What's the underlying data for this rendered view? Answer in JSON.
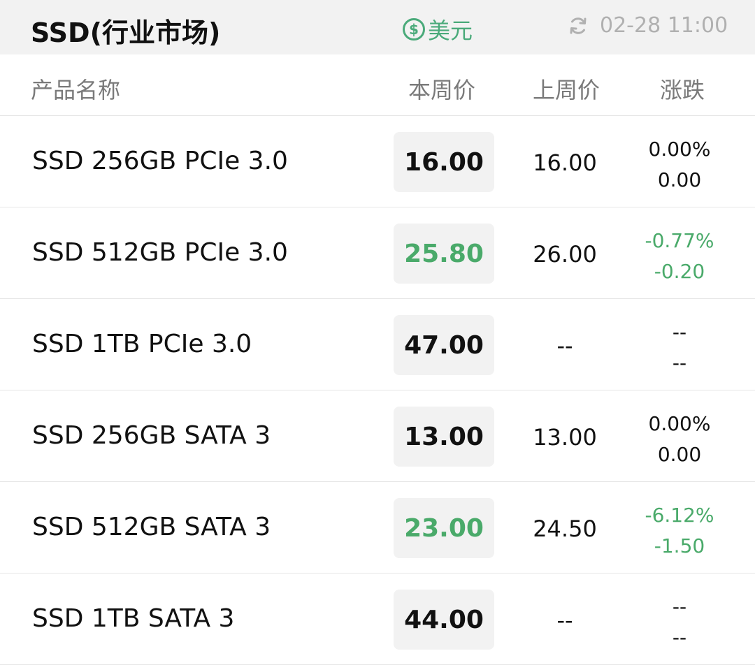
{
  "topbar": {
    "title": "SSD(行业市场)",
    "currency_symbol": "$",
    "currency_label": "美元",
    "updated_time": "02-28 11:00"
  },
  "table": {
    "headers": {
      "name": "产品名称",
      "this_week": "本周价",
      "last_week": "上周价",
      "change": "涨跌"
    },
    "rows": [
      {
        "name": "SSD 256GB PCIe 3.0",
        "this_week": "16.00",
        "last_week": "16.00",
        "change_pct": "0.00%",
        "change_abs": "0.00",
        "trend": "flat"
      },
      {
        "name": "SSD 512GB PCIe 3.0",
        "this_week": "25.80",
        "last_week": "26.00",
        "change_pct": "-0.77%",
        "change_abs": "-0.20",
        "trend": "down"
      },
      {
        "name": "SSD 1TB PCIe 3.0",
        "this_week": "47.00",
        "last_week": "--",
        "change_pct": "--",
        "change_abs": "--",
        "trend": "flat"
      },
      {
        "name": "SSD 256GB SATA 3",
        "this_week": "13.00",
        "last_week": "13.00",
        "change_pct": "0.00%",
        "change_abs": "0.00",
        "trend": "flat"
      },
      {
        "name": "SSD 512GB SATA 3",
        "this_week": "23.00",
        "last_week": "24.50",
        "change_pct": "-6.12%",
        "change_abs": "-1.50",
        "trend": "down"
      },
      {
        "name": "SSD 1TB SATA 3",
        "this_week": "44.00",
        "last_week": "--",
        "change_pct": "--",
        "change_abs": "--",
        "trend": "flat"
      }
    ]
  },
  "colors": {
    "down": "#4aaa6a",
    "accent": "#4aaa7a",
    "muted": "#b0b0b0"
  },
  "icons": {
    "currency": "dollar-circle-icon",
    "refresh": "refresh-icon"
  }
}
